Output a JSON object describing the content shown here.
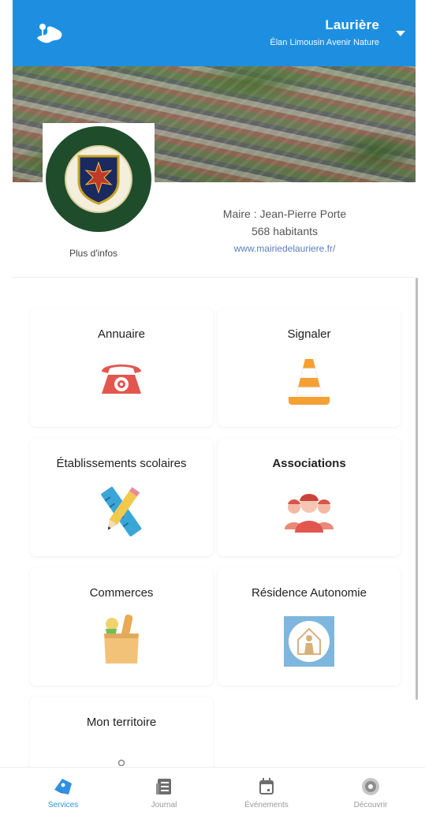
{
  "header": {
    "title": "Laurière",
    "subtitle": "Élan Limousin Avenir Nature",
    "icon": "map-icon",
    "menu_icon": "chevron-down-icon",
    "color": "#1e8fe0"
  },
  "info": {
    "more_label": "Plus d'infos",
    "mayor": "Maire : Jean-Pierre Porte",
    "population": "568 habitants",
    "website": "www.mairiedelauriere.fr/"
  },
  "tiles": [
    {
      "label": "Annuaire",
      "icon": "phone-icon"
    },
    {
      "label": "Signaler",
      "icon": "traffic-cone-icon"
    },
    {
      "label": "Établissements scolaires",
      "icon": "ruler-pencil-icon"
    },
    {
      "label": "Associations",
      "icon": "people-icon"
    },
    {
      "label": "Commerces",
      "icon": "grocery-bag-icon"
    },
    {
      "label": "Résidence Autonomie",
      "icon": "residence-icon"
    },
    {
      "label": "Mon territoire",
      "icon": "map-pin-icon"
    }
  ],
  "nav": [
    {
      "label": "Services",
      "icon": "services-icon",
      "active": true
    },
    {
      "label": "Journal",
      "icon": "newspaper-icon",
      "active": false
    },
    {
      "label": "Événements",
      "icon": "calendar-icon",
      "active": false
    },
    {
      "label": "Découvrir",
      "icon": "compass-icon",
      "active": false
    }
  ],
  "colors": {
    "accent": "#1e8fe0",
    "link": "#5b7fbf",
    "inactive": "#9a9a9a"
  }
}
